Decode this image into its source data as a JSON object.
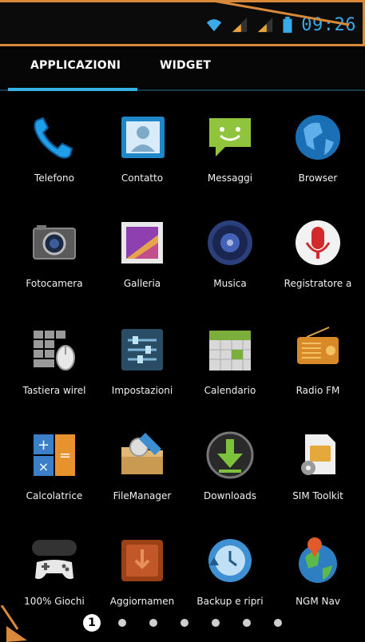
{
  "status_bar": {
    "time": "09:26",
    "icons": [
      "wifi-icon",
      "signal-icon",
      "signal-icon",
      "battery-icon"
    ]
  },
  "tabs": [
    {
      "label": "APPLICAZIONI",
      "active": true
    },
    {
      "label": "WIDGET",
      "active": false
    }
  ],
  "apps": [
    {
      "label": "Telefono",
      "icon": "phone-icon"
    },
    {
      "label": "Contatto",
      "icon": "contacts-icon"
    },
    {
      "label": "Messaggi",
      "icon": "messages-icon"
    },
    {
      "label": "Browser",
      "icon": "browser-icon"
    },
    {
      "label": "Fotocamera",
      "icon": "camera-icon"
    },
    {
      "label": "Galleria",
      "icon": "gallery-icon"
    },
    {
      "label": "Musica",
      "icon": "music-icon"
    },
    {
      "label": "Registratore a",
      "icon": "recorder-icon"
    },
    {
      "label": "Tastiera wirel",
      "icon": "keyboard-icon"
    },
    {
      "label": "Impostazioni",
      "icon": "settings-icon"
    },
    {
      "label": "Calendario",
      "icon": "calendar-icon"
    },
    {
      "label": "Radio FM",
      "icon": "radio-icon"
    },
    {
      "label": "Calcolatrice",
      "icon": "calculator-icon"
    },
    {
      "label": "FileManager",
      "icon": "file-manager-icon"
    },
    {
      "label": "Downloads",
      "icon": "downloads-icon"
    },
    {
      "label": "SIM Toolkit",
      "icon": "sim-toolkit-icon"
    },
    {
      "label": "100% Giochi",
      "icon": "games-icon"
    },
    {
      "label": "Aggiornamen",
      "icon": "update-icon"
    },
    {
      "label": "Backup e ripri",
      "icon": "backup-icon"
    },
    {
      "label": "NGM Nav",
      "icon": "navigation-icon"
    }
  ],
  "pager": {
    "current": "1",
    "total_pages": 7
  },
  "colors": {
    "accent": "#32b5e5",
    "annotation": "#d88a3a",
    "background": "#000000"
  }
}
